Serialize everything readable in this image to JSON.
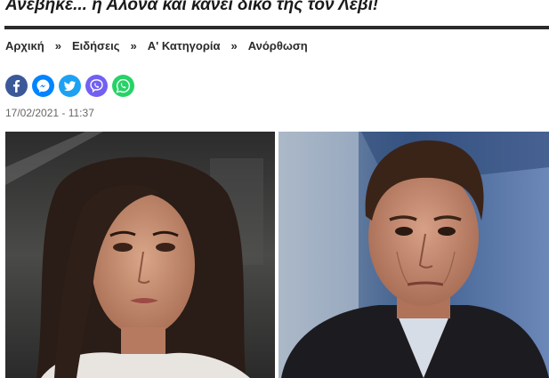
{
  "article": {
    "title": "Ανέβηκε... η Αλόνα και κάνει δικό της τον Λέβι!",
    "date": "17/02/2021 - 11:37"
  },
  "breadcrumb": {
    "items": [
      {
        "label": "Αρχική"
      },
      {
        "label": "Ειδήσεις"
      },
      {
        "label": "Α' Κατηγορία"
      },
      {
        "label": "Ανόρθωση"
      }
    ],
    "separator": "»"
  },
  "share": {
    "buttons": [
      {
        "icon": "facebook-icon",
        "color": "#3b5998"
      },
      {
        "icon": "messenger-icon",
        "color": "#0084ff"
      },
      {
        "icon": "twitter-icon",
        "color": "#1da1f2"
      },
      {
        "icon": "viber-icon",
        "color": "#7360f2"
      },
      {
        "icon": "whatsapp-icon",
        "color": "#25d366"
      }
    ]
  },
  "photo": {
    "left_background": "#3a3a3a",
    "right_background": "#5a7ea8"
  }
}
